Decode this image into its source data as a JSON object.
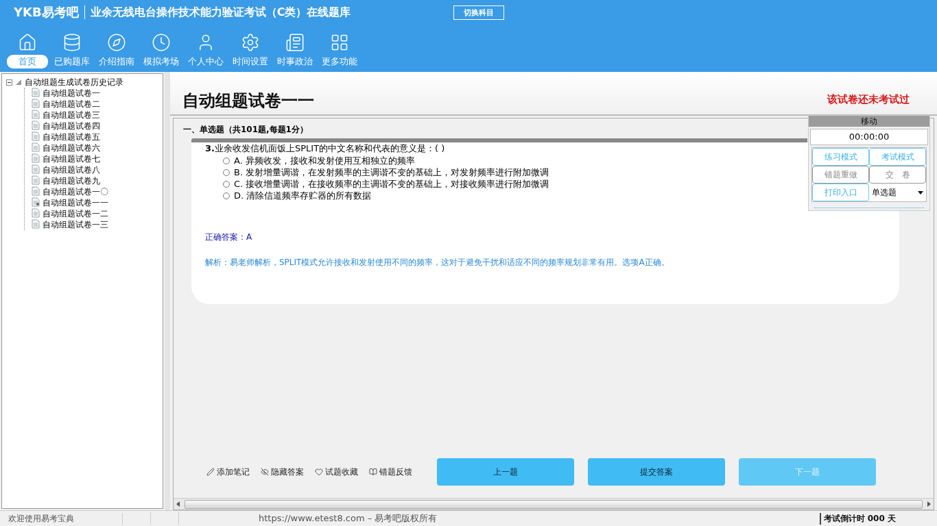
{
  "header": {
    "logo": "YKB易考吧",
    "title": "业余无线电台操作技术能力验证考试（C类）在线题库",
    "switch_button": "切换科目"
  },
  "nav": [
    {
      "label": "首页",
      "selected": true
    },
    {
      "label": "已购题库",
      "selected": false
    },
    {
      "label": "介绍指南",
      "selected": false
    },
    {
      "label": "模拟考场",
      "selected": false
    },
    {
      "label": "个人中心",
      "selected": false
    },
    {
      "label": "时间设置",
      "selected": false
    },
    {
      "label": "时事政治",
      "selected": false
    },
    {
      "label": "更多功能",
      "selected": false
    }
  ],
  "tree": {
    "label": "自动组题生成试卷历史记录",
    "expanded": true,
    "children": [
      {
        "label": "自动组题试卷一",
        "marked": false
      },
      {
        "label": "自动组题试卷二",
        "marked": false
      },
      {
        "label": "自动组题试卷三",
        "marked": false
      },
      {
        "label": "自动组题试卷四",
        "marked": false
      },
      {
        "label": "自动组题试卷五",
        "marked": false
      },
      {
        "label": "自动组题试卷六",
        "marked": false
      },
      {
        "label": "自动组题试卷七",
        "marked": false
      },
      {
        "label": "自动组题试卷八",
        "marked": false
      },
      {
        "label": "自动组题试卷九",
        "marked": false
      },
      {
        "label": "自动组题试卷一〇",
        "marked": false
      },
      {
        "label": "自动组题试卷一一",
        "marked": true
      },
      {
        "label": "自动组题试卷一二",
        "marked": false
      },
      {
        "label": "自动组题试卷一三",
        "marked": false
      }
    ]
  },
  "paper": {
    "title": "自动组题试卷一一",
    "status": "该试卷还未考试过",
    "section": "一、单选题（共101题,每题1分）"
  },
  "question": {
    "number": "3.",
    "text": "业余收发信机面饭上SPLIT的中文名称和代表的意义是：( )",
    "options": [
      {
        "label": "A. 异频收发，接收和发射使用互相独立的频率",
        "checked": false
      },
      {
        "label": "B. 发射增量调谐，在发射频率的主调谐不变的基础上，对发射频率进行附加微调",
        "checked": false
      },
      {
        "label": "C. 接收增量调谐，在接收频率的主调谐不变的基础上，对接收频率进行附加微调",
        "checked": false
      },
      {
        "label": "D. 清除信道频率存贮器的所有数据",
        "checked": false
      }
    ],
    "answer": "正确答案：A",
    "analysis": "解析：易老师解析，SPLIT模式允许接收和发射使用不同的频率，这对于避免干扰和适应不同的频率规划非常有用。选项A正确。"
  },
  "side_panel": {
    "title": "移动",
    "timer": "00:00:00",
    "buttons": [
      {
        "label": "练习模式",
        "disabled": false
      },
      {
        "label": "考试模式",
        "disabled": false
      },
      {
        "label": "错题重做",
        "disabled": true
      },
      {
        "label": "交　卷",
        "disabled": true
      },
      {
        "label": "打印入口",
        "disabled": false
      }
    ],
    "type_select": "单选题"
  },
  "tools": [
    {
      "label": "添加笔记"
    },
    {
      "label": "隐藏答案"
    },
    {
      "label": "试题收藏"
    },
    {
      "label": "错题反馈"
    }
  ],
  "actions": [
    {
      "label": "上一题",
      "disabled": false
    },
    {
      "label": "提交答案",
      "disabled": false
    },
    {
      "label": "下一题",
      "disabled": true
    }
  ],
  "status_bar": {
    "welcome": "欢迎使用易考宝典",
    "copyright": "https://www.etest8.com – 易考吧版权所有",
    "countdown": "考试倒计时 000 天"
  }
}
